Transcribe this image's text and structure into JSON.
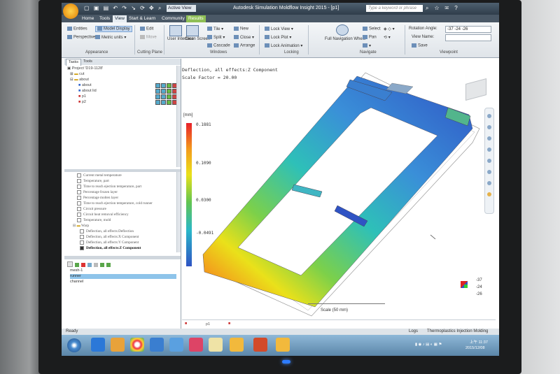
{
  "app": {
    "title": "Autodesk Simulation Moldflow Insight 2015 - [p1]",
    "view_selector": "Active View",
    "search_placeholder": "Type a keyword or phrase",
    "qat_icons": [
      "new-icon",
      "open-icon",
      "save-icon",
      "undo-icon",
      "redo-icon",
      "select-icon",
      "rotate-icon",
      "pan-icon",
      "zoom-icon"
    ]
  },
  "tabs": [
    "Home",
    "Tools",
    "View",
    "Start & Learn",
    "Community",
    "Results"
  ],
  "active_tab": "View",
  "ribbon": {
    "appearance": {
      "label": "Appearance",
      "entities": "Entities",
      "model_display": "Model Display",
      "perspective": "Perspective",
      "units": "Metric units"
    },
    "cutting_plane": {
      "label": "Cutting Plane",
      "edit": "Edit",
      "move": "Move"
    },
    "windows": {
      "label": "Windows",
      "user_interface": "User Interface",
      "clean_screen": "Clean Screen",
      "tile": "Tile",
      "split": "Split",
      "cascade": "Cascade",
      "new": "New",
      "close": "Close",
      "arrange": "Arrange"
    },
    "locking": {
      "label": "Locking",
      "lock_view": "Lock View",
      "lock_plot": "Lock Plot",
      "lock_animation": "Lock Animation"
    },
    "navigate": {
      "label": "Navigate",
      "full_nav": "Full Navigation Wheel",
      "select": "Select",
      "pan": "Pan"
    },
    "viewpoint": {
      "label": "Viewpoint",
      "rotation_angle_label": "Rotation Angle:",
      "rotation_angle_value": "-37 -24 -26",
      "view_name_label": "View Name:",
      "save": "Save"
    }
  },
  "left_pane": {
    "tabs": [
      "Tasks",
      "Tools"
    ],
    "tree": [
      {
        "label": "Project 'D19-1128'",
        "level": 0
      },
      {
        "label": "cut",
        "level": 1
      },
      {
        "label": "about",
        "level": 1
      },
      {
        "label": "about",
        "level": 2
      },
      {
        "label": "about lid",
        "level": 2
      },
      {
        "label": "p1",
        "level": 2
      },
      {
        "label": "p2",
        "level": 2
      }
    ],
    "results": [
      {
        "label": "Current metal temperature",
        "checked": false,
        "bold": false
      },
      {
        "label": "Temperature, part",
        "checked": false,
        "bold": false
      },
      {
        "label": "Time to reach ejection temperature, part",
        "checked": false,
        "bold": false
      },
      {
        "label": "Percentage frozen layer",
        "checked": false,
        "bold": false
      },
      {
        "label": "Percentage molten layer",
        "checked": false,
        "bold": false
      },
      {
        "label": "Time to reach ejection temperature, cold runner",
        "checked": false,
        "bold": false
      },
      {
        "label": "Circuit pressure",
        "checked": false,
        "bold": false
      },
      {
        "label": "Circuit heat removal efficiency",
        "checked": false,
        "bold": false
      },
      {
        "label": "Temperature, mold",
        "checked": false,
        "bold": false
      },
      {
        "label": "Warp",
        "checked": false,
        "bold": false
      },
      {
        "label": "Deflection, all effects:Deflection",
        "checked": false,
        "bold": false
      },
      {
        "label": "Deflection, all effects:X Component",
        "checked": false,
        "bold": false
      },
      {
        "label": "Deflection, all effects:Y Component",
        "checked": false,
        "bold": false
      },
      {
        "label": "Deflection, all effects:Z Component",
        "checked": true,
        "bold": true
      }
    ],
    "layers": [
      {
        "label": "mesh-1",
        "selected": false
      },
      {
        "label": "runner",
        "selected": true
      },
      {
        "label": "channel",
        "selected": false
      }
    ]
  },
  "viewport": {
    "plot_title": "Deflection, all effects:Z Component",
    "scale_factor": "Scale Factor = 20.00",
    "unit": "[mm]",
    "legend_ticks": [
      "0.1881",
      "0.1090",
      "0.0300",
      "-0.0491"
    ],
    "scale_bar": "Scale (50 mm)",
    "triad_angles": [
      "-37",
      "-24",
      "-26"
    ],
    "bottom_tab": "p1"
  },
  "status": {
    "text": "Ready",
    "logs": "Logs",
    "analysis": "Thermoplastics Injection Molding"
  },
  "taskbar": {
    "icons": [
      "ie-icon",
      "outlook-icon",
      "chrome-icon",
      "folder-icon",
      "app-icon",
      "photo-icon",
      "files-icon",
      "moldflow-icon",
      "powerpoint-icon",
      "moldflow2-icon"
    ],
    "time": "上午 11:37",
    "date": "2015/12/08"
  },
  "colors": {
    "legend_top": "#e8202a",
    "legend_bottom": "#2f53c4",
    "results_tab": "#8fbf55",
    "selection": "#8ec4ea"
  }
}
